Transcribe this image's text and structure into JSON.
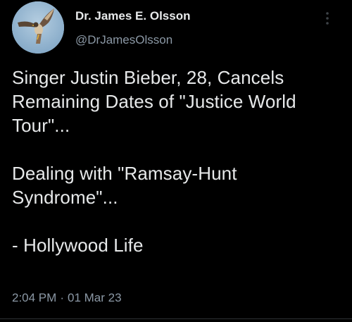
{
  "author": {
    "display_name": "Dr. James E. Olsson",
    "handle": "@DrJamesOlsson",
    "avatar_icon": "hawk-avatar-icon"
  },
  "tweet": {
    "lines": [
      "Singer Justin Bieber, 28, Cancels",
      "Remaining Dates of \"Justice World",
      "Tour\"...",
      "Dealing with \"Ramsay-Hunt",
      "Syndrome\"...",
      "- Hollywood Life"
    ],
    "time": "2:04 PM",
    "separator": "·",
    "date": "01 Mar 23"
  },
  "colors": {
    "background": "#000000",
    "primary_text": "#e7e9ea",
    "secondary_text": "#8b98a5",
    "avatar_sky": "#8fb2cf"
  }
}
